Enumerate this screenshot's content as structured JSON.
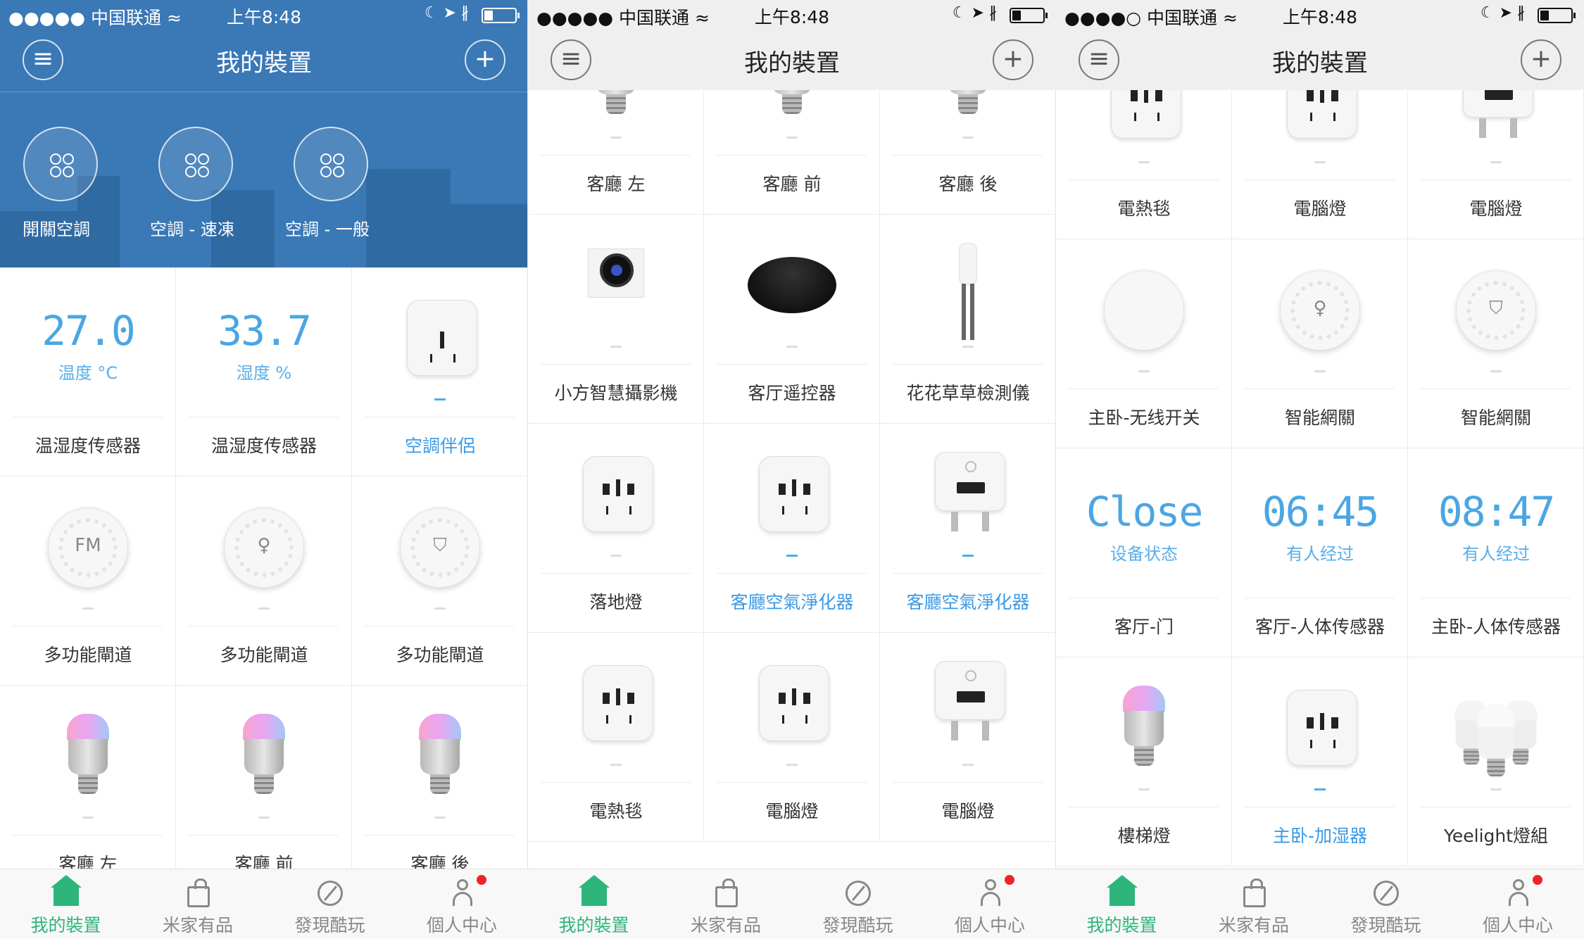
{
  "status": {
    "carrier": "中国联通",
    "time": "上午8:48"
  },
  "nav": {
    "title": "我的裝置"
  },
  "scenes": [
    "開關空調",
    "空調 - 速凍",
    "空調 - 一般"
  ],
  "p1": {
    "cells": [
      {
        "big": "27.0",
        "sub": "温度 °C",
        "name": "温湿度传感器",
        "blue": false,
        "art": "reading"
      },
      {
        "big": "33.7",
        "sub": "湿度 %",
        "name": "温湿度传感器",
        "blue": false,
        "art": "reading"
      },
      {
        "name": "空調伴侶",
        "blue": true,
        "art": "usbplug"
      },
      {
        "name": "多功能閘道",
        "blue": false,
        "art": "fm"
      },
      {
        "name": "多功能閘道",
        "blue": false,
        "art": "gw-bulb"
      },
      {
        "name": "多功能閘道",
        "blue": false,
        "art": "gw-shield"
      },
      {
        "name": "客廳 左",
        "blue": false,
        "art": "bulb"
      },
      {
        "name": "客廳 前",
        "blue": false,
        "art": "bulb"
      },
      {
        "name": "客廳 後",
        "blue": false,
        "art": "bulb"
      }
    ]
  },
  "p2": {
    "cells": [
      {
        "name": "客廳 左",
        "blue": false,
        "art": "bulb"
      },
      {
        "name": "客廳 前",
        "blue": false,
        "art": "bulb"
      },
      {
        "name": "客廳 後",
        "blue": false,
        "art": "bulb"
      },
      {
        "name": "小方智慧攝影機",
        "blue": false,
        "art": "cam"
      },
      {
        "name": "客厅遥控器",
        "blue": false,
        "art": "ir"
      },
      {
        "name": "花花草草檢測儀",
        "blue": false,
        "art": "flora"
      },
      {
        "name": "落地燈",
        "blue": false,
        "art": "plug"
      },
      {
        "name": "客廳空氣淨化器",
        "blue": true,
        "art": "plug"
      },
      {
        "name": "客廳空氣淨化器",
        "blue": true,
        "art": "usb"
      },
      {
        "name": "電熱毯",
        "blue": false,
        "art": "plug"
      },
      {
        "name": "電腦燈",
        "blue": false,
        "art": "plug"
      },
      {
        "name": "電腦燈",
        "blue": false,
        "art": "usb"
      }
    ]
  },
  "p3": {
    "cells": [
      {
        "name": "電熱毯",
        "blue": false,
        "art": "plug"
      },
      {
        "name": "電腦燈",
        "blue": false,
        "art": "plug"
      },
      {
        "name": "電腦燈",
        "blue": false,
        "art": "usb"
      },
      {
        "name": "主卧-无线开关",
        "blue": false,
        "art": "switch"
      },
      {
        "name": "智能網關",
        "blue": false,
        "art": "gw-bulb"
      },
      {
        "name": "智能網關",
        "blue": false,
        "art": "gw-shield"
      },
      {
        "big": "Close",
        "sub": "设备状态",
        "name": "客厅-门",
        "blue": false,
        "art": "reading"
      },
      {
        "big": "06:45",
        "sub": "有人经过",
        "name": "客厅-人体传感器",
        "blue": false,
        "art": "reading"
      },
      {
        "big": "08:47",
        "sub": "有人经过",
        "name": "主卧-人体传感器",
        "blue": false,
        "art": "reading"
      },
      {
        "name": "樓梯燈",
        "blue": false,
        "art": "bulb"
      },
      {
        "name": "主卧-加湿器",
        "blue": true,
        "art": "plug"
      },
      {
        "name": "Yeelight燈組",
        "blue": false,
        "art": "bulbset"
      }
    ]
  },
  "tabs": [
    "我的裝置",
    "米家有品",
    "發現酷玩",
    "個人中心"
  ]
}
